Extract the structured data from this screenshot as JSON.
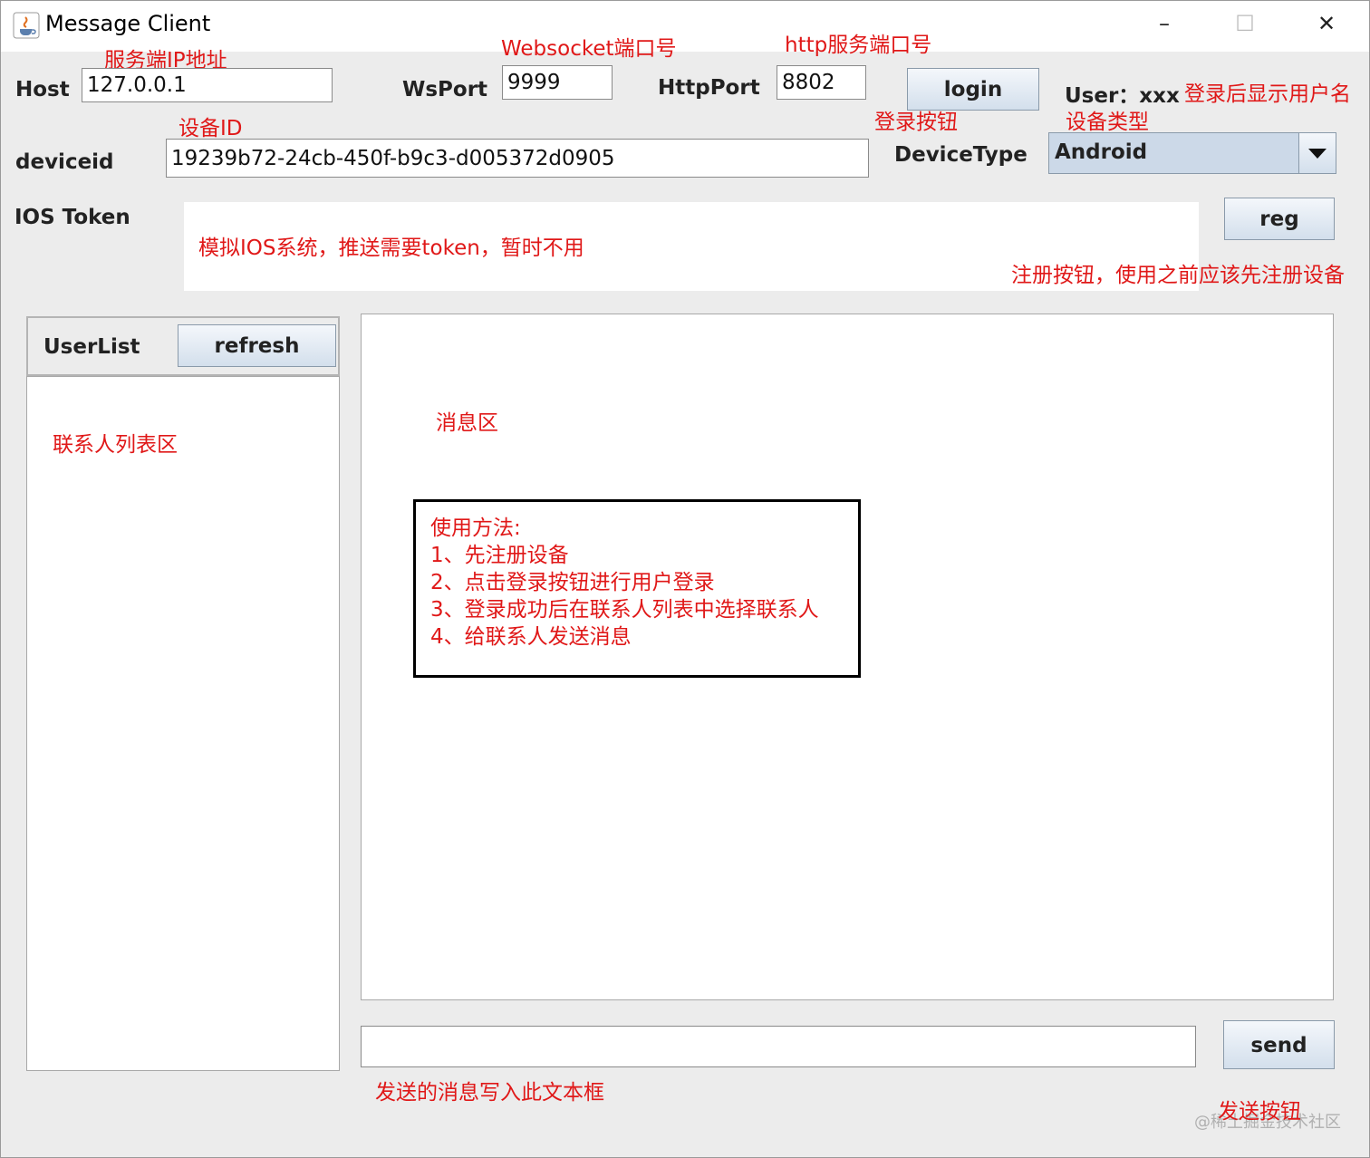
{
  "window": {
    "title": "Message Client",
    "minimize": "–",
    "maximize": "☐",
    "close": "✕"
  },
  "form": {
    "host_label": "Host",
    "host_value": "127.0.0.1",
    "wsport_label": "WsPort",
    "wsport_value": "9999",
    "httpport_label": "HttpPort",
    "httpport_value": "8802",
    "login_label": "login",
    "user_text": "User：xxx",
    "deviceid_label": "deviceid",
    "deviceid_value": "19239b72-24cb-450f-b9c3-d005372d0905",
    "devicetype_label": "DeviceType",
    "devicetype_value": "Android",
    "ios_token_label": "IOS Token",
    "ios_token_value": "",
    "reg_label": "reg"
  },
  "userlist": {
    "label": "UserList",
    "refresh_label": "refresh"
  },
  "composer": {
    "message_value": "",
    "send_label": "send"
  },
  "annotations": {
    "host": "服务端IP地址",
    "wsport": "Websocket端口号",
    "httpport": "http服务端口号",
    "login": "登录按钮",
    "user": "登录后显示用户名",
    "devicetype": "设备类型",
    "deviceid": "设备ID",
    "ios_token": "模拟IOS系统，推送需要token，暂时不用",
    "reg": "注册按钮，使用之前应该先注册设备",
    "userlist": "联系人列表区",
    "message_area": "消息区",
    "input": "发送的消息写入此文本框",
    "send": "发送按钮"
  },
  "usage": {
    "title": "使用方法:",
    "steps": [
      "1、先注册设备",
      "2、点击登录按钮进行用户登录",
      "3、登录成功后在联系人列表中选择联系人",
      "4、给联系人发送消息"
    ]
  },
  "watermark": "@稀土掘金技术社区"
}
